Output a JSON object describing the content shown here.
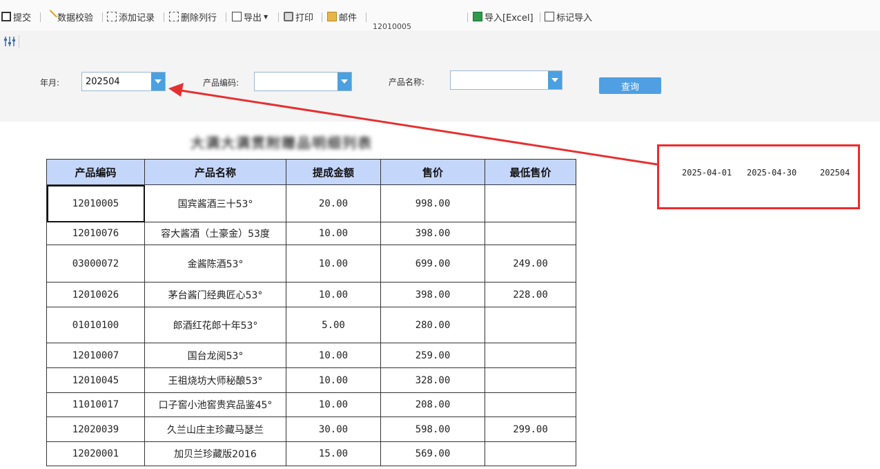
{
  "toolbar": {
    "submit": "提交",
    "validate": "数据校验",
    "add_record": "添加记录",
    "delete_row": "删除列行",
    "export": "导出",
    "print": "打印",
    "mail": "邮件",
    "cell_ref": "12010005",
    "import_excel": "导入[Excel]",
    "mark_import": "标记导入"
  },
  "filters": {
    "year_month_label": "年月:",
    "year_month_value": "202504",
    "product_code_label": "产品编码:",
    "product_code_value": "",
    "product_name_label": "产品名称:",
    "product_name_value": "",
    "query_button": "查询"
  },
  "report": {
    "title": "大满大满贯附赠品明细列表",
    "columns": [
      "产品编码",
      "产品名称",
      "提成金额",
      "售价",
      "最低售价"
    ],
    "rows": [
      {
        "code": "12010005",
        "name": "国宾酱酒三十53°",
        "commission": "20.00",
        "price": "998.00",
        "min_price": ""
      },
      {
        "code": "12010076",
        "name": "容大酱酒（土豪金）53度",
        "commission": "10.00",
        "price": "398.00",
        "min_price": ""
      },
      {
        "code": "03000072",
        "name": "金酱陈酒53°",
        "commission": "10.00",
        "price": "699.00",
        "min_price": "249.00"
      },
      {
        "code": "12010026",
        "name": "茅台酱门经典匠心53°",
        "commission": "10.00",
        "price": "398.00",
        "min_price": "228.00"
      },
      {
        "code": "01010100",
        "name": "郎酒红花郎十年53°",
        "commission": "5.00",
        "price": "280.00",
        "min_price": ""
      },
      {
        "code": "12010007",
        "name": "国台龙阅53°",
        "commission": "10.00",
        "price": "259.00",
        "min_price": ""
      },
      {
        "code": "12010045",
        "name": "王祖烧坊大师秘酿53°",
        "commission": "10.00",
        "price": "328.00",
        "min_price": ""
      },
      {
        "code": "11010017",
        "name": "口子窖小池窖贵宾品鉴45°",
        "commission": "10.00",
        "price": "208.00",
        "min_price": ""
      },
      {
        "code": "12020039",
        "name": "久兰山庄主珍藏马瑟兰",
        "commission": "30.00",
        "price": "598.00",
        "min_price": "299.00"
      },
      {
        "code": "12020001",
        "name": "加贝兰珍藏版2016",
        "commission": "15.00",
        "price": "569.00",
        "min_price": ""
      }
    ]
  },
  "callout": {
    "start_date": "2025-04-01",
    "end_date": "2025-04-30",
    "period": "202504",
    "border_color": "#ec2b2b"
  },
  "colors": {
    "header_bg": "#c5d6fb",
    "accent": "#4aa0e0"
  }
}
